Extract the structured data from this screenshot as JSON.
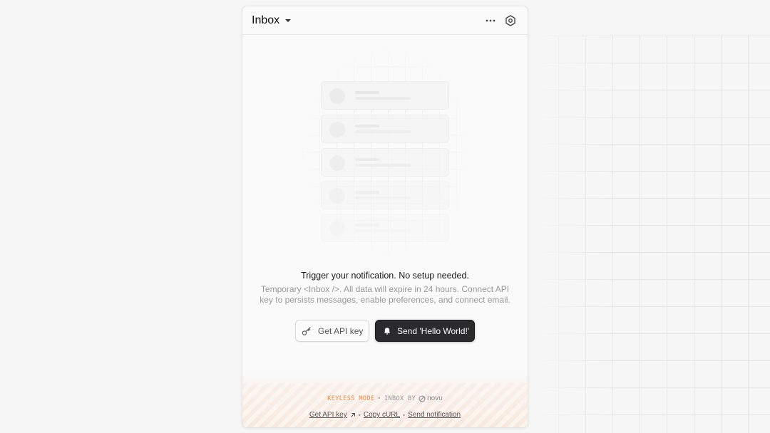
{
  "inbox": {
    "title": "Inbox",
    "heading": "Trigger your notification. No setup needed.",
    "description": "Temporary <Inbox />. All data will expire in 24 hours. Connect API key to persists messages, enable preferences, and connect email.",
    "buttons": {
      "get_api_key": "Get API key",
      "send_hello": "Send 'Hello World!'"
    }
  },
  "footer": {
    "mode_label": "KEYLESS MODE",
    "separator": "•",
    "inbox_by": "INBOX BY",
    "brand": "novu",
    "links": [
      "Get API key",
      "Copy cURL",
      "Send notification"
    ]
  },
  "colors": {
    "accent_orange": "#e58c4c",
    "primary_button": "#2b2b2d"
  },
  "icons": {
    "header": [
      "more-horizontal-icon",
      "settings-hexagon-icon"
    ],
    "buttons": [
      "key-icon",
      "bell-icon"
    ],
    "footer": [
      "external-link-icon",
      "novu-logo-icon"
    ]
  }
}
